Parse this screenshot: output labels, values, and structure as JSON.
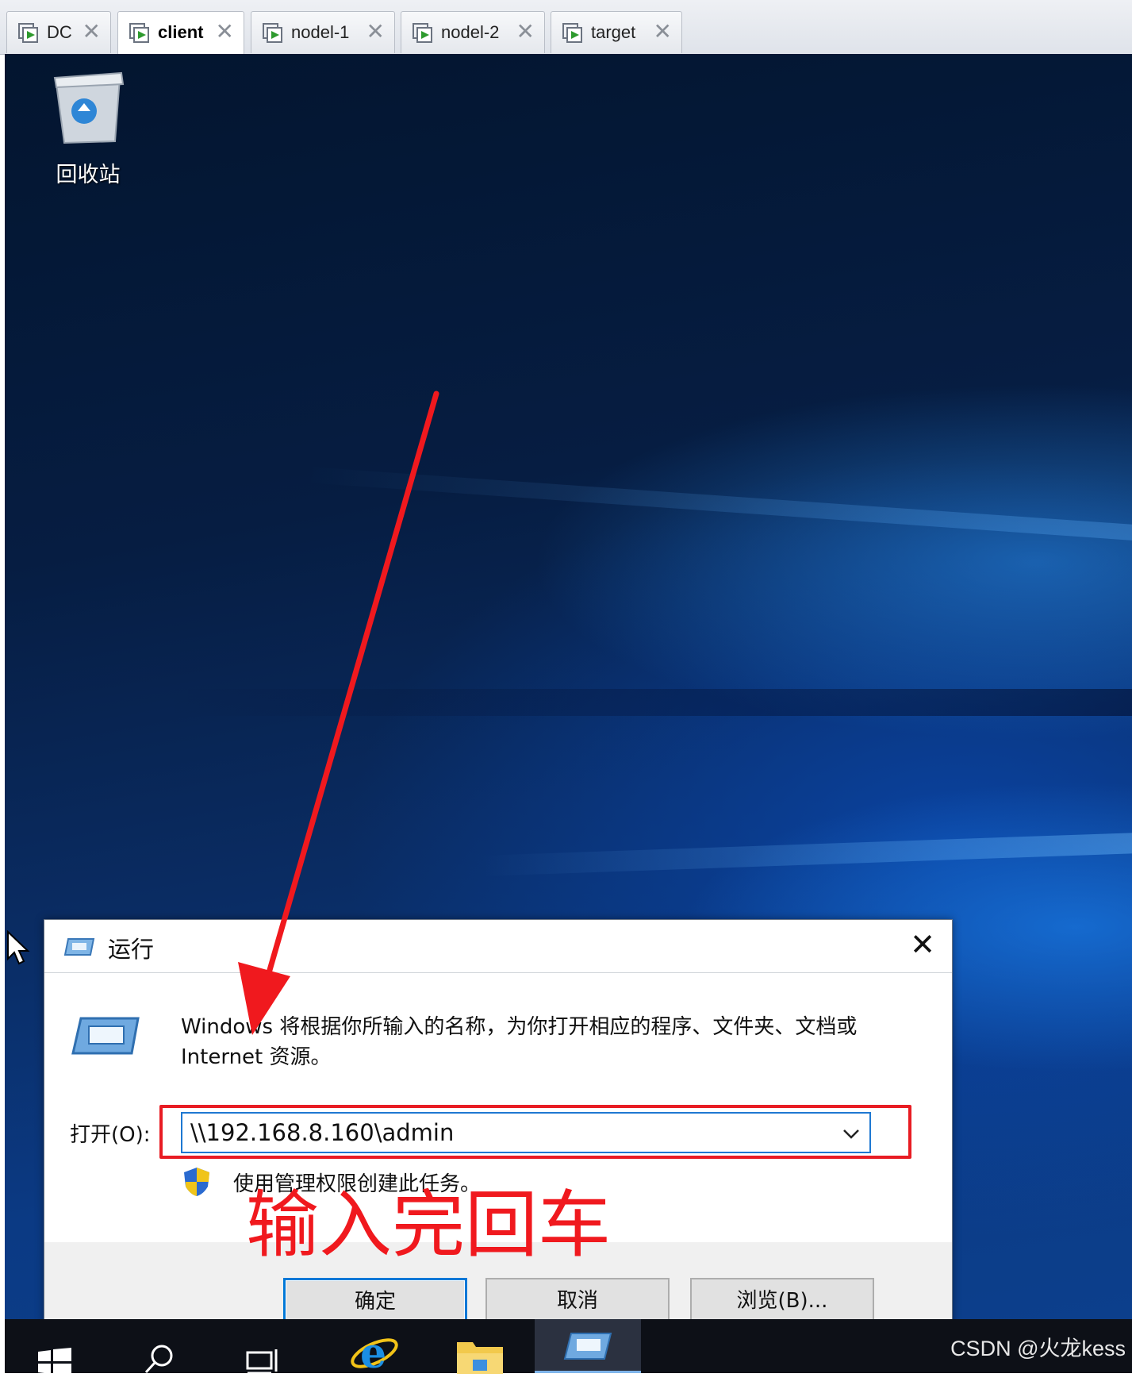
{
  "tabs": [
    {
      "label": "DC",
      "active": false,
      "icon": "vm-running-icon"
    },
    {
      "label": "client",
      "active": true,
      "icon": "vm-running-icon"
    },
    {
      "label": "nodel-1",
      "active": false,
      "icon": "vm-running-icon"
    },
    {
      "label": "nodel-2",
      "active": false,
      "icon": "vm-running-icon"
    },
    {
      "label": "target",
      "active": false,
      "icon": "vm-running-icon"
    }
  ],
  "tab_close_glyph": "✕",
  "desktop": {
    "recycle_bin_label": "回收站"
  },
  "run_dialog": {
    "title": "运行",
    "close_glyph": "✕",
    "description": "Windows 将根据你所输入的名称，为你打开相应的程序、文件夹、文档或 Internet 资源。",
    "open_label": "打开(O):",
    "open_value": "\\\\192.168.8.160\\admin",
    "admin_note": "使用管理权限创建此任务。",
    "buttons": {
      "ok": "确定",
      "cancel": "取消",
      "browse": "浏览(B)..."
    }
  },
  "annotation": {
    "text": "输入完回车",
    "color": "#f0191e"
  },
  "taskbar": {
    "items": [
      "windows-start-icon",
      "search-icon",
      "task-view-icon",
      "internet-explorer-icon",
      "file-explorer-icon",
      "run-app-icon"
    ]
  },
  "watermark": "CSDN @火龙kess",
  "colors": {
    "accent": "#0078d7",
    "annotation_red": "#e81c23",
    "taskbar": "#0d1017"
  }
}
